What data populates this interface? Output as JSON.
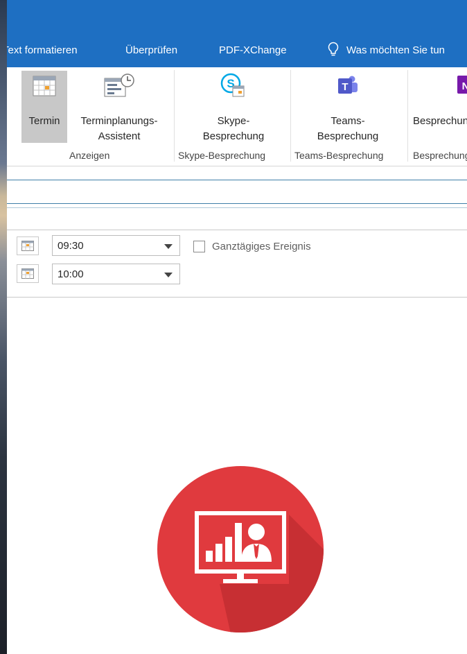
{
  "menu": {
    "tabs": [
      "Text formatieren",
      "Überprüfen",
      "PDF-XChange"
    ],
    "tell_me": "Was möchten Sie tun"
  },
  "ribbon": {
    "termin": "Termin",
    "terminplanung_line1": "Terminplanungs-",
    "terminplanung_line2": "Assistent",
    "skype_line1": "Skype-",
    "skype_line2": "Besprechung",
    "teams_line1": "Teams-",
    "teams_line2": "Besprechung",
    "onenote": "Besprechung",
    "groups": {
      "anzeigen": "Anzeigen",
      "skype": "Skype-Besprechung",
      "teams": "Teams-Besprechung",
      "onenote": "Besprechung"
    }
  },
  "form": {
    "start_time": "09:30",
    "end_time": "10:00",
    "all_day_label": "Ganztägiges Ereignis",
    "all_day_checked": false
  },
  "colors": {
    "title_bar": "#1e6fc2",
    "skype": "#00a8e6",
    "teams": "#5059c9",
    "onenote": "#7719aa",
    "badge": "#e03a3e"
  },
  "icons": {
    "calendar": "calendar-icon",
    "scheduling": "scheduling-assistant-icon",
    "skype": "skype-icon",
    "teams": "teams-icon",
    "onenote": "onenote-icon",
    "lightbulb": "lightbulb-icon",
    "presentation": "presentation-monitor-icon"
  }
}
